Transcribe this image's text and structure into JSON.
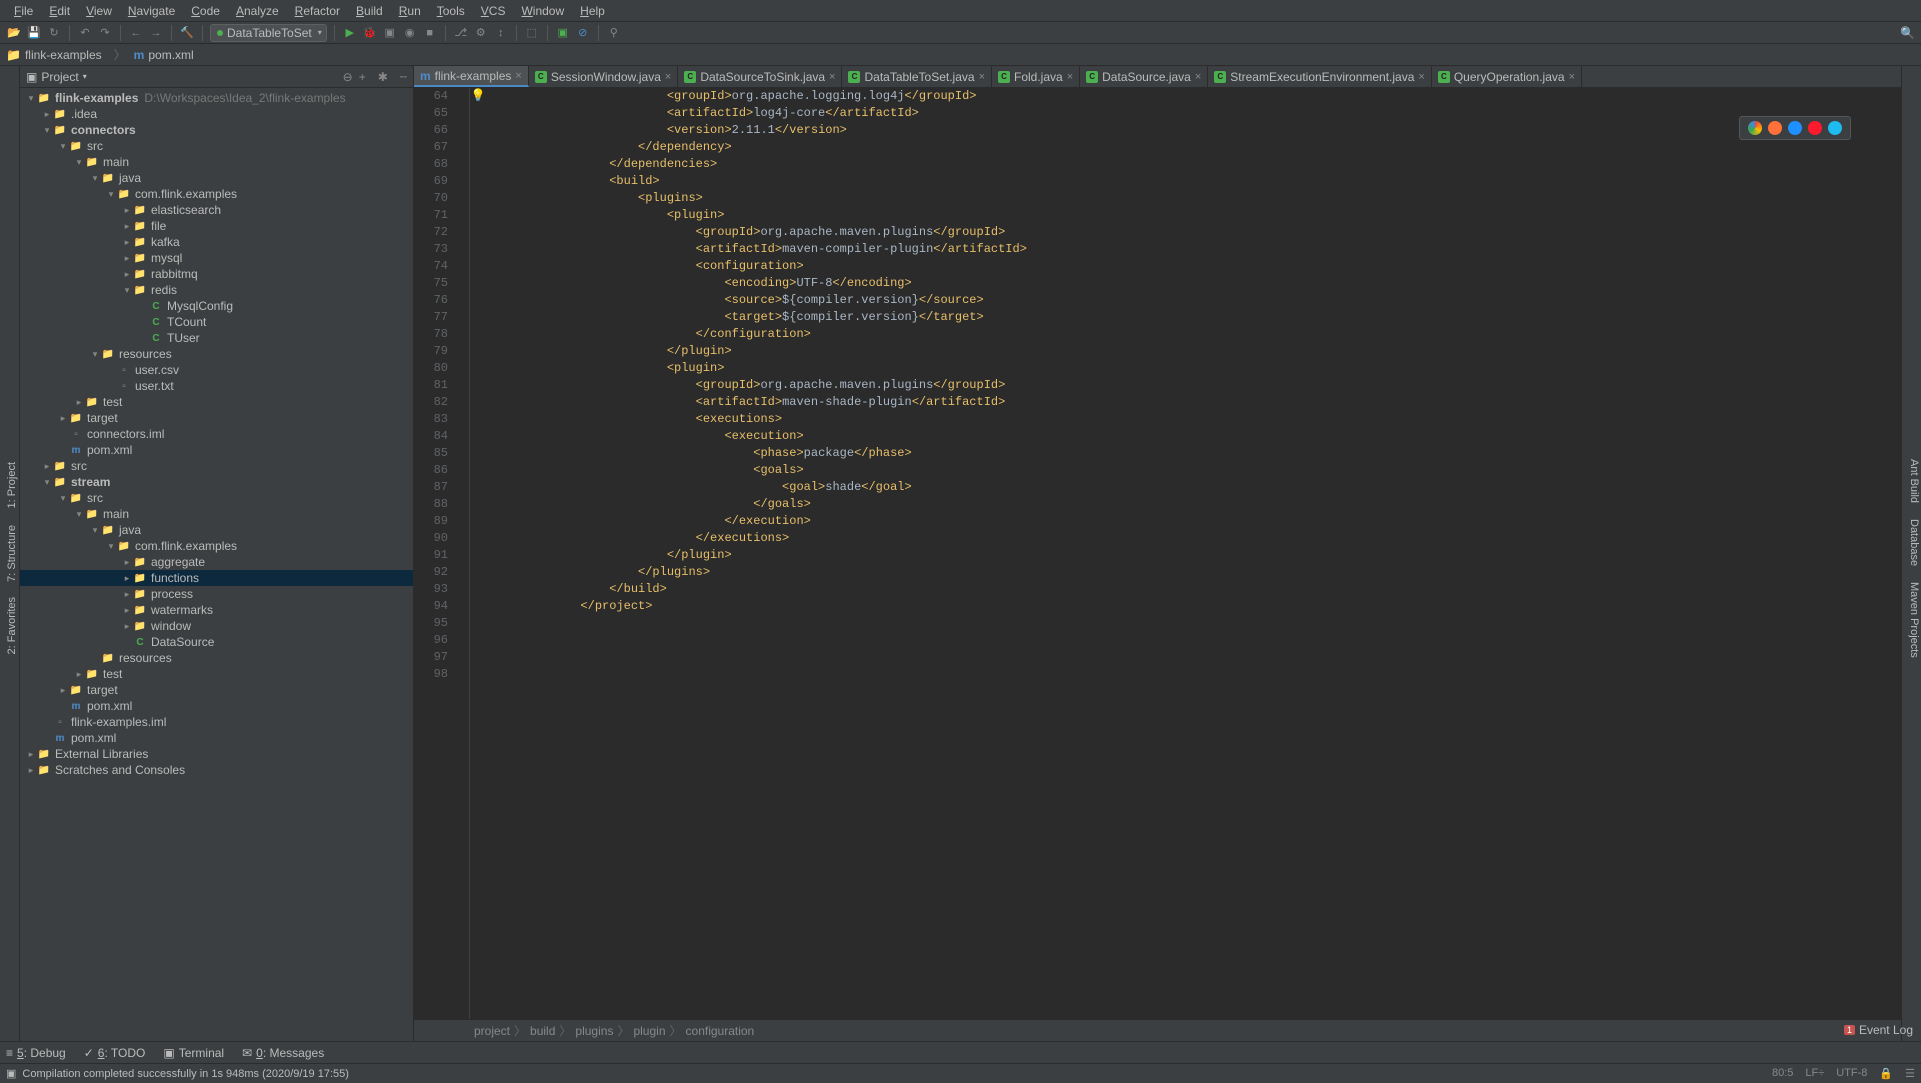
{
  "menu": [
    "File",
    "Edit",
    "View",
    "Navigate",
    "Code",
    "Analyze",
    "Refactor",
    "Build",
    "Run",
    "Tools",
    "VCS",
    "Window",
    "Help"
  ],
  "run_config": "DataTableToSet",
  "nav_items": [
    {
      "icon": "folder",
      "label": "flink-examples"
    },
    {
      "icon": "m",
      "label": "pom.xml"
    }
  ],
  "panel_title": "Project",
  "tree": [
    {
      "d": 0,
      "a": "exp",
      "i": "folder-blue",
      "t": "flink-examples",
      "suf": "D:\\Workspaces\\Idea_2\\flink-examples",
      "bold": true
    },
    {
      "d": 1,
      "a": "col",
      "i": "folder-open",
      "t": ".idea"
    },
    {
      "d": 1,
      "a": "exp",
      "i": "folder-blue",
      "t": "connectors",
      "bold": true
    },
    {
      "d": 2,
      "a": "exp",
      "i": "folder-open",
      "t": "src"
    },
    {
      "d": 3,
      "a": "exp",
      "i": "folder-open",
      "t": "main"
    },
    {
      "d": 4,
      "a": "exp",
      "i": "folder-blue",
      "t": "java"
    },
    {
      "d": 5,
      "a": "exp",
      "i": "folder-open",
      "t": "com.flink.examples"
    },
    {
      "d": 6,
      "a": "col",
      "i": "folder-open",
      "t": "elasticsearch"
    },
    {
      "d": 6,
      "a": "col",
      "i": "folder-open",
      "t": "file"
    },
    {
      "d": 6,
      "a": "col",
      "i": "folder-open",
      "t": "kafka"
    },
    {
      "d": 6,
      "a": "col",
      "i": "folder-open",
      "t": "mysql"
    },
    {
      "d": 6,
      "a": "col",
      "i": "folder-open",
      "t": "rabbitmq"
    },
    {
      "d": 6,
      "a": "exp",
      "i": "folder-open",
      "t": "redis"
    },
    {
      "d": 7,
      "a": "",
      "i": "file-c",
      "t": "MysqlConfig"
    },
    {
      "d": 7,
      "a": "",
      "i": "file-c",
      "t": "TCount"
    },
    {
      "d": 7,
      "a": "",
      "i": "file-c",
      "t": "TUser"
    },
    {
      "d": 4,
      "a": "exp",
      "i": "folder-open",
      "t": "resources"
    },
    {
      "d": 5,
      "a": "",
      "i": "file-generic",
      "t": "user.csv"
    },
    {
      "d": 5,
      "a": "",
      "i": "file-generic",
      "t": "user.txt"
    },
    {
      "d": 3,
      "a": "col",
      "i": "folder-open",
      "t": "test"
    },
    {
      "d": 2,
      "a": "col",
      "i": "folder-orange",
      "t": "target"
    },
    {
      "d": 2,
      "a": "",
      "i": "file-generic",
      "t": "connectors.iml"
    },
    {
      "d": 2,
      "a": "",
      "i": "file-m",
      "t": "pom.xml"
    },
    {
      "d": 1,
      "a": "col",
      "i": "folder-open",
      "t": "src"
    },
    {
      "d": 1,
      "a": "exp",
      "i": "folder-blue",
      "t": "stream",
      "bold": true
    },
    {
      "d": 2,
      "a": "exp",
      "i": "folder-open",
      "t": "src"
    },
    {
      "d": 3,
      "a": "exp",
      "i": "folder-open",
      "t": "main"
    },
    {
      "d": 4,
      "a": "exp",
      "i": "folder-blue",
      "t": "java"
    },
    {
      "d": 5,
      "a": "exp",
      "i": "folder-open",
      "t": "com.flink.examples"
    },
    {
      "d": 6,
      "a": "col",
      "i": "folder-open",
      "t": "aggregate"
    },
    {
      "d": 6,
      "a": "col",
      "i": "folder-open",
      "t": "functions",
      "sel": true
    },
    {
      "d": 6,
      "a": "col",
      "i": "folder-open",
      "t": "process"
    },
    {
      "d": 6,
      "a": "col",
      "i": "folder-open",
      "t": "watermarks"
    },
    {
      "d": 6,
      "a": "col",
      "i": "folder-open",
      "t": "window"
    },
    {
      "d": 6,
      "a": "",
      "i": "file-c",
      "t": "DataSource"
    },
    {
      "d": 4,
      "a": "",
      "i": "folder-open",
      "t": "resources"
    },
    {
      "d": 3,
      "a": "col",
      "i": "folder-open",
      "t": "test"
    },
    {
      "d": 2,
      "a": "col",
      "i": "folder-orange",
      "t": "target"
    },
    {
      "d": 2,
      "a": "",
      "i": "file-m",
      "t": "pom.xml"
    },
    {
      "d": 1,
      "a": "",
      "i": "file-generic",
      "t": "flink-examples.iml"
    },
    {
      "d": 1,
      "a": "",
      "i": "file-m",
      "t": "pom.xml"
    },
    {
      "d": 0,
      "a": "col",
      "i": "folder-open",
      "t": "External Libraries"
    },
    {
      "d": 0,
      "a": "col",
      "i": "folder-open",
      "t": "Scratches and Consoles"
    }
  ],
  "tabs": [
    {
      "icon": "m",
      "label": "flink-examples",
      "active": true
    },
    {
      "icon": "c",
      "label": "SessionWindow.java"
    },
    {
      "icon": "c",
      "label": "DataSourceToSink.java"
    },
    {
      "icon": "c",
      "label": "DataTableToSet.java"
    },
    {
      "icon": "c",
      "label": "Fold.java"
    },
    {
      "icon": "c",
      "label": "DataSource.java"
    },
    {
      "icon": "c",
      "label": "StreamExecutionEnvironment.java"
    },
    {
      "icon": "c",
      "label": "QueryOperation.java"
    }
  ],
  "code_lines": [
    {
      "n": 64,
      "ind": 6,
      "seg": [
        [
          "tag",
          "<groupId>"
        ],
        [
          "txt",
          "org.apache.logging.log4j"
        ],
        [
          "tag",
          "</groupId>"
        ]
      ]
    },
    {
      "n": 65,
      "ind": 6,
      "seg": [
        [
          "tag",
          "<artifactId>"
        ],
        [
          "txt",
          "log4j-core"
        ],
        [
          "tag",
          "</artifactId>"
        ]
      ]
    },
    {
      "n": 66,
      "ind": 6,
      "seg": [
        [
          "tag",
          "<version>"
        ],
        [
          "txt",
          "2.11.1"
        ],
        [
          "tag",
          "</version>"
        ]
      ]
    },
    {
      "n": 67,
      "ind": 5,
      "seg": [
        [
          "tag",
          "</dependency>"
        ]
      ]
    },
    {
      "n": 68,
      "ind": 0,
      "seg": []
    },
    {
      "n": 69,
      "ind": 4,
      "seg": [
        [
          "tag",
          "</dependencies>"
        ]
      ]
    },
    {
      "n": 70,
      "ind": 0,
      "seg": []
    },
    {
      "n": 71,
      "ind": 4,
      "seg": [
        [
          "tag",
          "<build>"
        ]
      ]
    },
    {
      "n": 72,
      "ind": 5,
      "seg": [
        [
          "tag",
          "<plugins>"
        ]
      ]
    },
    {
      "n": 73,
      "ind": 6,
      "seg": [
        [
          "tag",
          "<plugin>"
        ]
      ]
    },
    {
      "n": 74,
      "ind": 7,
      "seg": [
        [
          "tag",
          "<groupId>"
        ],
        [
          "txt",
          "org.apache.maven.plugins"
        ],
        [
          "tag",
          "</groupId>"
        ]
      ]
    },
    {
      "n": 75,
      "ind": 7,
      "seg": [
        [
          "tag",
          "<artifactId>"
        ],
        [
          "txt",
          "maven-compiler-plugin"
        ],
        [
          "tag",
          "</artifactId>"
        ]
      ]
    },
    {
      "n": 76,
      "ind": 7,
      "seg": [
        [
          "tag",
          "<configuration>"
        ]
      ]
    },
    {
      "n": 77,
      "ind": 8,
      "seg": [
        [
          "tag",
          "<encoding>"
        ],
        [
          "txt",
          "UTF-8"
        ],
        [
          "tag",
          "</encoding>"
        ]
      ]
    },
    {
      "n": 78,
      "ind": 8,
      "seg": [
        [
          "tag",
          "<source>"
        ],
        [
          "txt",
          "${compiler.version}"
        ],
        [
          "tag",
          "</source>"
        ]
      ]
    },
    {
      "n": 79,
      "ind": 8,
      "seg": [
        [
          "tag",
          "<target>"
        ],
        [
          "txt",
          "${compiler.version}"
        ],
        [
          "tag",
          "</target>"
        ]
      ]
    },
    {
      "n": 80,
      "ind": 7,
      "bulb": true,
      "seg": [
        [
          "tag",
          "</configuration>"
        ]
      ]
    },
    {
      "n": 81,
      "ind": 6,
      "seg": [
        [
          "tag",
          "</plugin>"
        ]
      ]
    },
    {
      "n": 82,
      "ind": 0,
      "seg": []
    },
    {
      "n": 83,
      "ind": 6,
      "seg": [
        [
          "tag",
          "<plugin>"
        ]
      ]
    },
    {
      "n": 84,
      "ind": 7,
      "seg": [
        [
          "tag",
          "<groupId>"
        ],
        [
          "txt",
          "org.apache.maven.plugins"
        ],
        [
          "tag",
          "</groupId>"
        ]
      ]
    },
    {
      "n": 85,
      "ind": 7,
      "seg": [
        [
          "tag",
          "<artifactId>"
        ],
        [
          "txt",
          "maven-shade-plugin"
        ],
        [
          "tag",
          "</artifactId>"
        ]
      ]
    },
    {
      "n": 86,
      "ind": 7,
      "seg": [
        [
          "tag",
          "<executions>"
        ]
      ]
    },
    {
      "n": 87,
      "ind": 8,
      "seg": [
        [
          "tag",
          "<execution>"
        ]
      ]
    },
    {
      "n": 88,
      "ind": 9,
      "seg": [
        [
          "tag",
          "<phase>"
        ],
        [
          "txt",
          "package"
        ],
        [
          "tag",
          "</phase>"
        ]
      ]
    },
    {
      "n": 89,
      "ind": 9,
      "seg": [
        [
          "tag",
          "<goals>"
        ]
      ]
    },
    {
      "n": 90,
      "ind": 10,
      "seg": [
        [
          "tag",
          "<goal>"
        ],
        [
          "txt",
          "shade"
        ],
        [
          "tag",
          "</goal>"
        ]
      ]
    },
    {
      "n": 91,
      "ind": 9,
      "seg": [
        [
          "tag",
          "</goals>"
        ]
      ]
    },
    {
      "n": 92,
      "ind": 8,
      "seg": [
        [
          "tag",
          "</execution>"
        ]
      ]
    },
    {
      "n": 93,
      "ind": 7,
      "seg": [
        [
          "tag",
          "</executions>"
        ]
      ]
    },
    {
      "n": 94,
      "ind": 6,
      "seg": [
        [
          "tag",
          "</plugin>"
        ]
      ]
    },
    {
      "n": 95,
      "ind": 5,
      "seg": [
        [
          "tag",
          "</plugins>"
        ]
      ]
    },
    {
      "n": 96,
      "ind": 4,
      "seg": [
        [
          "tag",
          "</build>"
        ]
      ]
    },
    {
      "n": 97,
      "ind": 0,
      "seg": []
    },
    {
      "n": 98,
      "ind": 3,
      "seg": [
        [
          "tag",
          "</project>"
        ]
      ]
    }
  ],
  "breadcrumbs": [
    "project",
    "build",
    "plugins",
    "plugin",
    "configuration"
  ],
  "bottom_tabs": [
    {
      "icon": "≡",
      "label": "5: Debug",
      "u": "5"
    },
    {
      "icon": "✓",
      "label": "6: TODO",
      "u": "6"
    },
    {
      "icon": "▣",
      "label": "Terminal"
    },
    {
      "icon": "✉",
      "label": "0: Messages",
      "u": "0"
    }
  ],
  "event_log": "Event Log",
  "status_message": "Compilation completed successfully in 1s 948ms (2020/9/19 17:55)",
  "status_right": {
    "pos": "80:5",
    "le": "LF÷",
    "enc": "UTF-8",
    "lock": "🔒"
  },
  "left_tabs": [
    "1: Project",
    "7: Structure",
    "2: Favorites"
  ],
  "right_tabs": [
    "Ant Build",
    "Database",
    "Maven Projects"
  ]
}
